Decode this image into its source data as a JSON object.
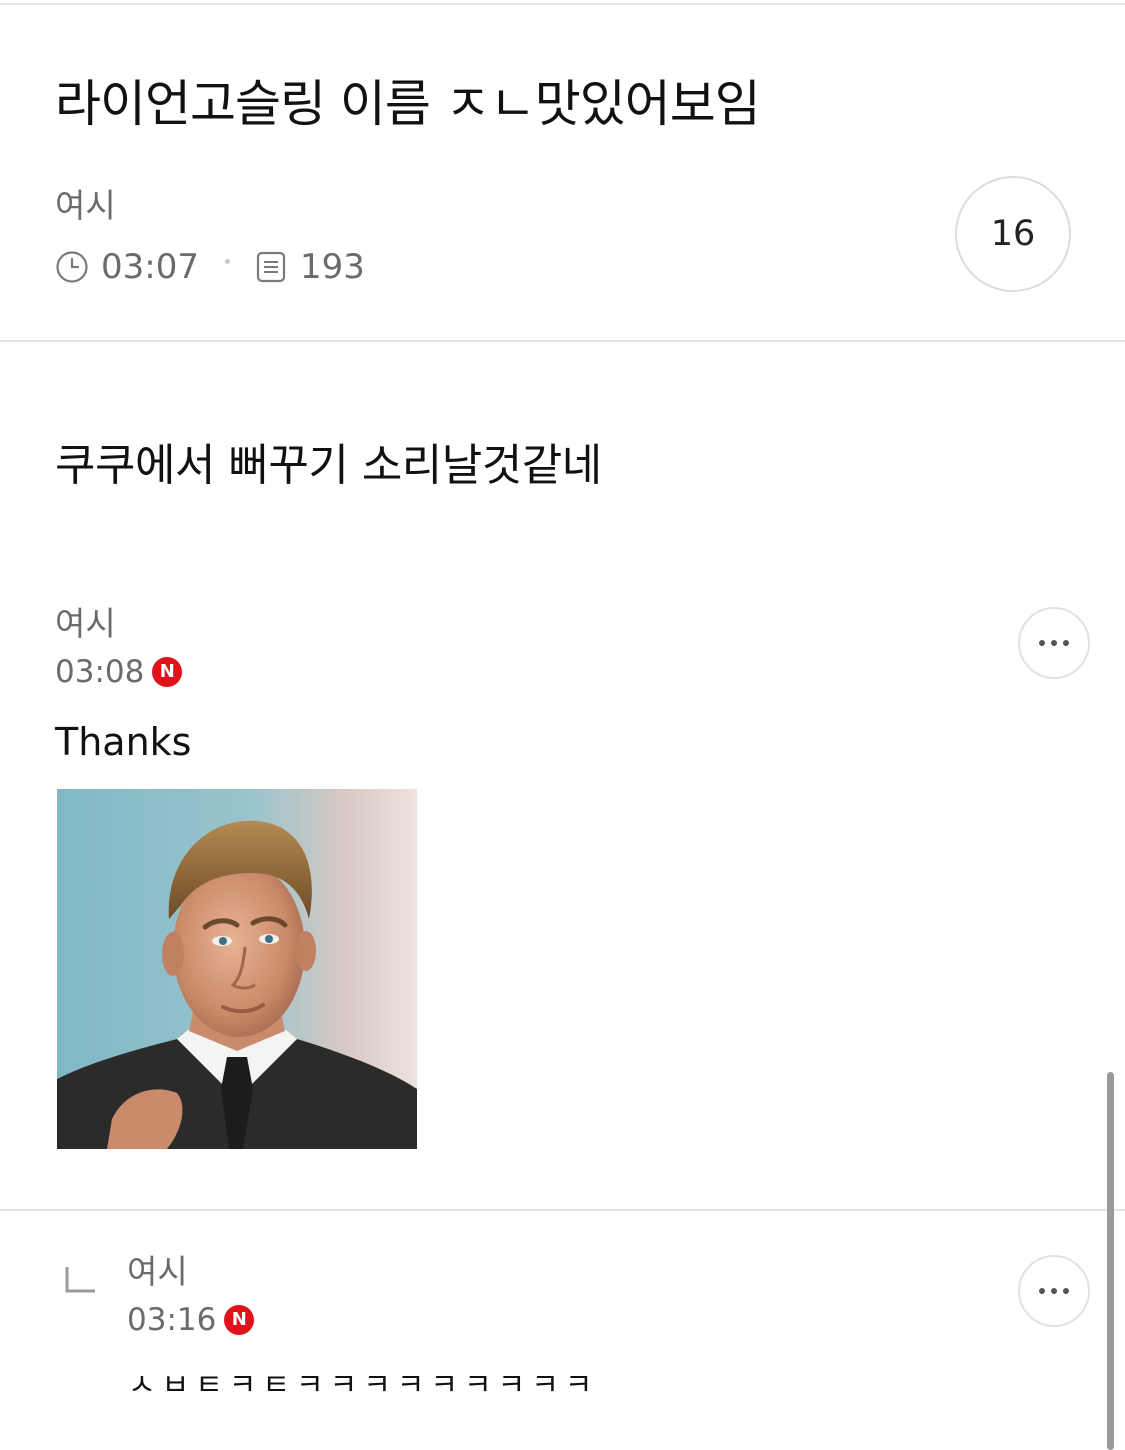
{
  "post": {
    "title": "라이언고슬링 이름 ㅈㄴ맛있어보임",
    "author": "여시",
    "time": "03:07",
    "views": "193",
    "comment_count": "16",
    "body": "쿠쿠에서 뻐꾸기 소리날것같네"
  },
  "comments": [
    {
      "author": "여시",
      "time": "03:08",
      "badge": "N",
      "text": "Thanks"
    },
    {
      "author": "여시",
      "time": "03:16",
      "badge": "N",
      "text": "ㅅㅂㅌㅋㅌㅋㅋㅋㅋㅋㅋㅋㅋㅋ"
    }
  ],
  "icons": {
    "clock": "clock-icon",
    "views": "document-icon",
    "more": "more-icon",
    "reply": "reply-arrow-icon"
  },
  "colors": {
    "new_badge": "#e0121b",
    "meta_text": "#6b6b6b"
  }
}
